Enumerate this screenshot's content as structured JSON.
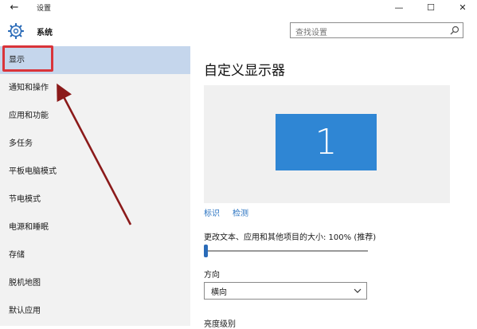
{
  "window": {
    "title": "设置",
    "back_glyph": "←",
    "minimize_glyph": "—",
    "maximize_glyph": "☐",
    "close_glyph": "✕"
  },
  "header": {
    "title": "系统",
    "icon": "gear-icon",
    "search": {
      "placeholder": "查找设置",
      "value": ""
    }
  },
  "sidebar": {
    "items": [
      {
        "label": "显示",
        "selected": true
      },
      {
        "label": "通知和操作",
        "selected": false
      },
      {
        "label": "应用和功能",
        "selected": false
      },
      {
        "label": "多任务",
        "selected": false
      },
      {
        "label": "平板电脑模式",
        "selected": false
      },
      {
        "label": "节电模式",
        "selected": false
      },
      {
        "label": "电源和睡眠",
        "selected": false
      },
      {
        "label": "存储",
        "selected": false
      },
      {
        "label": "脱机地图",
        "selected": false
      },
      {
        "label": "默认应用",
        "selected": false
      }
    ]
  },
  "main": {
    "title": "自定义显示器",
    "monitor_number": "1",
    "links": {
      "identify": "标识",
      "detect": "检测"
    },
    "scale": {
      "label": "更改文本、应用和其他项目的大小: 100% (推荐)",
      "level": 0
    },
    "orientation": {
      "label": "方向",
      "value": "横向"
    },
    "brightness": {
      "label": "亮度级别"
    }
  },
  "colors": {
    "accent": "#2f86d4",
    "sidebar_bg": "#f2f2f2",
    "selected_bg": "#c5d6ec",
    "annotation_red": "#d9343a",
    "annotation_arrow": "#8b1a1a",
    "link": "#2973c1"
  }
}
